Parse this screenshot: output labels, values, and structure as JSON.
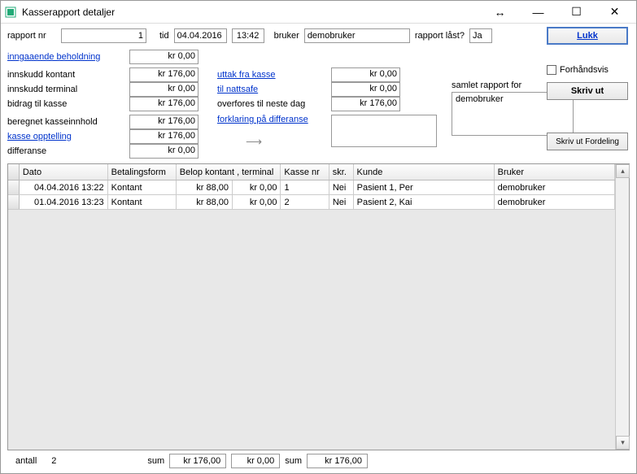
{
  "window": {
    "title": "Kasserapport detaljer"
  },
  "top": {
    "rapport_nr_label": "rapport nr",
    "rapport_nr": "1",
    "tid_label": "tid",
    "date": "04.04.2016",
    "time": "13:42",
    "bruker_label": "bruker",
    "bruker": "demobruker",
    "last_label": "rapport låst?",
    "last": "Ja"
  },
  "buttons": {
    "lukk": "Lukk",
    "forhandsvis": "Forhåndsvis",
    "skriv_ut": "Skriv ut",
    "skriv_ut_fordeling": "Skriv ut Fordeling"
  },
  "left": {
    "inngaende": "inngaaende beholdning",
    "inngaende_val": "kr 0,00",
    "innskudd_kontant": "innskudd kontant",
    "innskudd_kontant_val": "kr 176,00",
    "innskudd_terminal": "innskudd terminal",
    "innskudd_terminal_val": "kr 0,00",
    "bidrag": "bidrag til kasse",
    "bidrag_val": "kr 176,00",
    "beregnet": "beregnet kasseinnhold",
    "beregnet_val": "kr 176,00",
    "kasse_opptelling": "kasse opptelling",
    "kasse_opptelling_val": "kr 176,00",
    "differanse": "differanse",
    "differanse_val": "kr 0,00"
  },
  "mid": {
    "uttak": "uttak fra kasse",
    "uttak_val": "kr 0,00",
    "nattsafe": "til nattsafe",
    "nattsafe_val": "kr 0,00",
    "overfores": "overfores til neste dag",
    "overfores_val": "kr 176,00",
    "forklaring": "forklaring på differanse"
  },
  "samlet": {
    "label": "samlet rapport for",
    "value": "demobruker"
  },
  "grid": {
    "headers": {
      "dato": "Dato",
      "betalingsform": "Betalingsform",
      "belop": "Belop kontant , terminal",
      "kasse": "Kasse nr",
      "skr": "skr.",
      "kunde": "Kunde",
      "bruker": "Bruker"
    },
    "rows": [
      {
        "dato": "04.04.2016 13:22",
        "bet": "Kontant",
        "belk": "kr 88,00",
        "belt": "kr 0,00",
        "kasse": "1",
        "skr": "Nei",
        "kunde": "Pasient 1, Per",
        "bruker": "demobruker"
      },
      {
        "dato": "01.04.2016 13:23",
        "bet": "Kontant",
        "belk": "kr 88,00",
        "belt": "kr 0,00",
        "kasse": "2",
        "skr": "Nei",
        "kunde": "Pasient 2, Kai",
        "bruker": "demobruker"
      }
    ]
  },
  "footer": {
    "antall_label": "antall",
    "antall": "2",
    "sum_label": "sum",
    "sum_kontant": "kr 176,00",
    "sum_terminal": "kr 0,00",
    "sum2_label": "sum",
    "sum_total": "kr 176,00"
  }
}
